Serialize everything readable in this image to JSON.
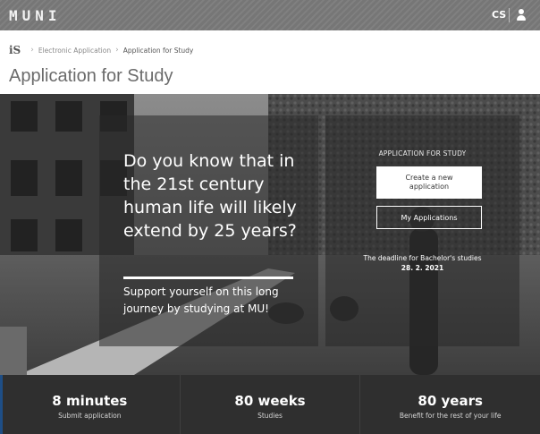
{
  "header": {
    "logo_text": "MUNI",
    "language": "CS",
    "user_icon": "user-icon"
  },
  "breadcrumb": {
    "logo": "iS",
    "items": [
      "Electronic Application",
      "Application for Study"
    ]
  },
  "page": {
    "title": "Application for Study"
  },
  "hero": {
    "headline": "Do you know that in the 21st century human life will likely extend by 25 years?",
    "subtext": "Support yourself on this long journey by studying at MU!",
    "panel_label": "APPLICATION FOR STUDY",
    "create_button": "Create a new application",
    "my_applications_button": "My Applications",
    "deadline_text": "The deadline for Bachelor's studies",
    "deadline_date": "28. 2. 2021"
  },
  "stats": [
    {
      "value": "8 minutes",
      "label": "Submit application"
    },
    {
      "value": "80 weeks",
      "label": "Studies"
    },
    {
      "value": "80 years",
      "label": "Benefit for the rest of your life"
    }
  ],
  "colors": {
    "topbar": "#767676",
    "stats_bar": "#2f2f2f",
    "accent_blue": "#1e4e86",
    "panel_overlay": "rgba(40,40,40,0.55)"
  }
}
